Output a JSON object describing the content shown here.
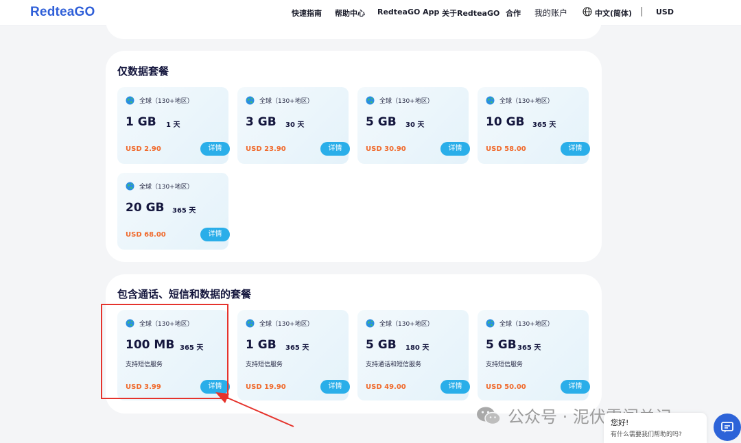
{
  "header": {
    "logo": "RedteaGO",
    "nav": [
      "快速指南",
      "帮助中心",
      "RedteaGO App",
      "关于RedteaGO",
      "合作"
    ],
    "account": "我的账户",
    "language": "中文(简体)",
    "currency": "USD"
  },
  "sections": [
    {
      "title": "仅数据套餐",
      "cards": [
        {
          "region": "全球（130+地区）",
          "amount": "1 GB",
          "days": "1 天",
          "price": "USD 2.90",
          "button": "详情"
        },
        {
          "region": "全球（130+地区）",
          "amount": "3 GB",
          "days": "30 天",
          "price": "USD 23.90",
          "button": "详情"
        },
        {
          "region": "全球（130+地区）",
          "amount": "5 GB",
          "days": "30 天",
          "price": "USD 30.90",
          "button": "详情"
        },
        {
          "region": "全球（130+地区）",
          "amount": "10 GB",
          "days": "365 天",
          "price": "USD 58.00",
          "button": "详情"
        },
        {
          "region": "全球（130+地区）",
          "amount": "20 GB",
          "days": "365 天",
          "price": "USD 68.00",
          "button": "详情"
        }
      ]
    },
    {
      "title": "包含通话、短信和数据的套餐",
      "cards": [
        {
          "region": "全球（130+地区）",
          "amount": "100 MB",
          "days": "365 天",
          "feature": "支持短信服务",
          "price": "USD 3.99",
          "button": "详情"
        },
        {
          "region": "全球（130+地区）",
          "amount": "1 GB",
          "days": "365 天",
          "feature": "支持短信服务",
          "price": "USD 19.90",
          "button": "详情"
        },
        {
          "region": "全球（130+地区）",
          "amount": "5 GB",
          "days": "180 天",
          "feature": "支持通话和短信服务",
          "price": "USD 49.00",
          "button": "详情"
        },
        {
          "region": "全球（130+地区）",
          "amount": "5 GB",
          "days": "365 天",
          "feature": "支持短信服务",
          "price": "USD 50.00",
          "button": "详情"
        }
      ]
    }
  ],
  "watermark": "公众号 · 泥伏雷闯关记",
  "chat": {
    "greeting": "您好!",
    "prompt": "有什么需要我们帮助的吗?"
  },
  "colors": {
    "brand": "#2f5fd8",
    "price": "#f06a2c",
    "button": "#2aaee9",
    "highlight": "#e5332c"
  }
}
